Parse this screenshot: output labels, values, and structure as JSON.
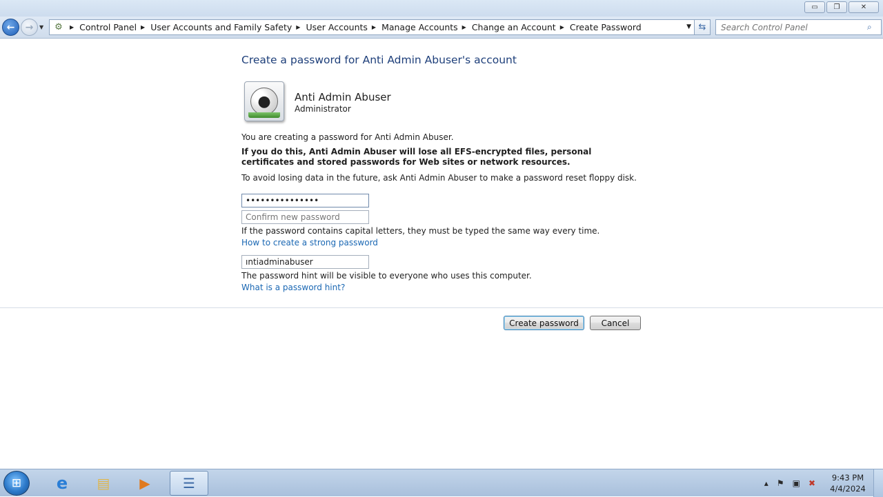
{
  "window_controls": {
    "minimize": "▭",
    "restore": "❐",
    "close": "✕"
  },
  "nav": {
    "breadcrumbs": [
      "Control Panel",
      "User Accounts and Family Safety",
      "User Accounts",
      "Manage Accounts",
      "Change an Account",
      "Create Password"
    ],
    "search_placeholder": "Search Control Panel"
  },
  "page": {
    "heading": "Create a password for Anti Admin Abuser's account",
    "user": {
      "name": "Anti Admin Abuser",
      "role": "Administrator",
      "avatar_icon": "soccer-ball-icon"
    },
    "intro_text": "You are creating a password for Anti Admin Abuser.",
    "warning_text": "If you do this, Anti Admin Abuser will lose all EFS-encrypted files, personal certificates and stored passwords for Web sites or network resources.",
    "advice_text": "To avoid losing data in the future, ask Anti Admin Abuser to make a password reset floppy disk.",
    "new_password_value": "•••••••••••••••",
    "confirm_placeholder": "Confirm new password",
    "capital_note": "If the password contains capital letters, they must be typed the same way every time.",
    "strong_password_link": "How to create a strong password",
    "hint_value": "ıntiadminabuser",
    "hint_note": "The password hint will be visible to everyone who uses this computer.",
    "hint_link": "What is a password hint?",
    "create_button": "Create password",
    "cancel_button": "Cancel"
  },
  "taskbar": {
    "items": [
      "start-orb",
      "internet-explorer",
      "windows-explorer",
      "media-player",
      "control-panel"
    ],
    "clock_time": "9:43 PM",
    "clock_date": "4/4/2024"
  },
  "colors": {
    "heading": "#1e3f7a",
    "link": "#1a67b3",
    "taskbar": "#a9c0dc"
  }
}
